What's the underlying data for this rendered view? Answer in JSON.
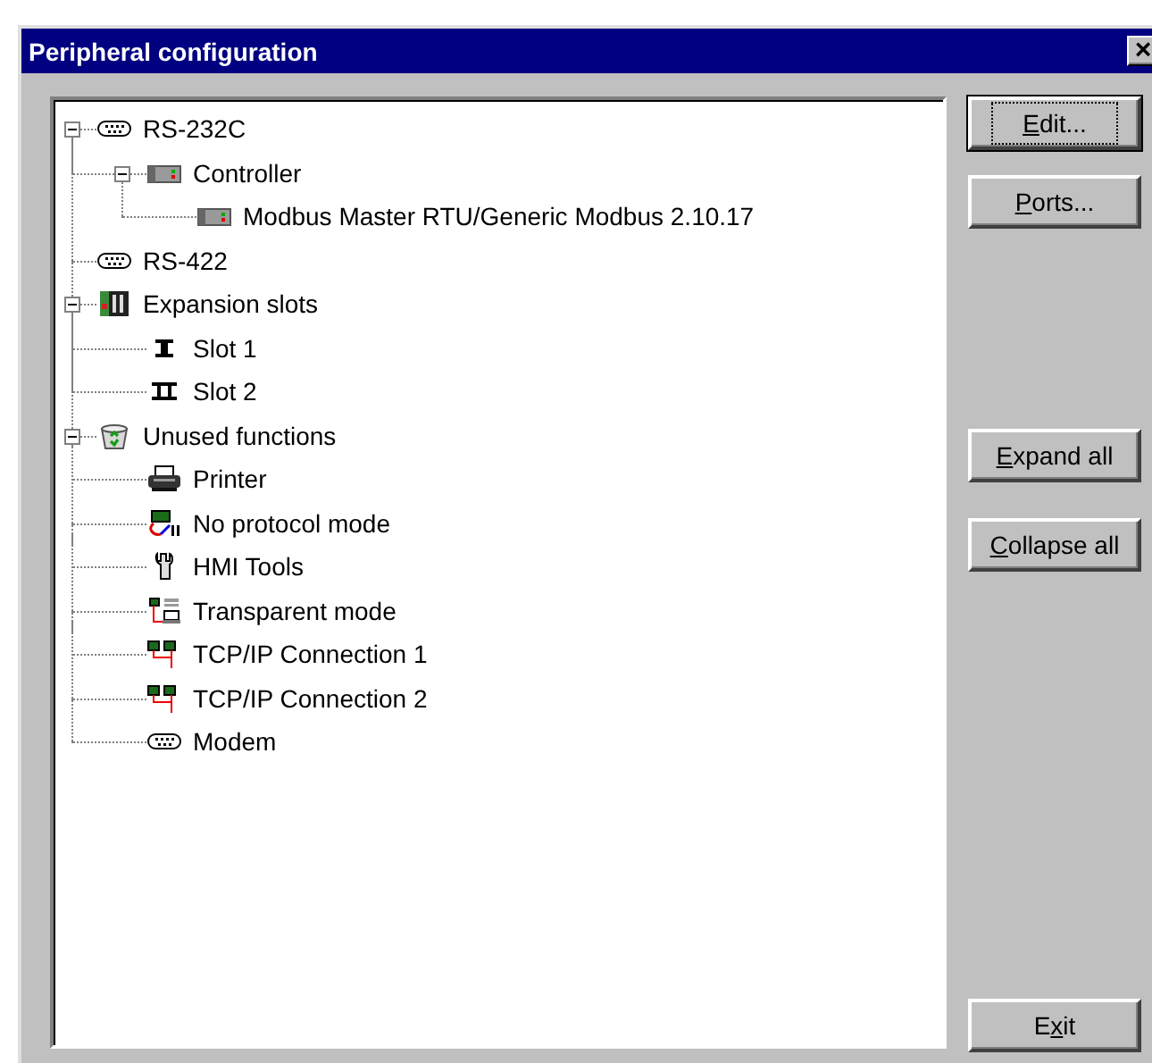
{
  "window": {
    "title": "Peripheral configuration",
    "close": "×"
  },
  "tree": [
    {
      "label": "RS-232C",
      "kind": "serial-port",
      "expanded": true,
      "children": [
        {
          "label": "Controller",
          "kind": "controller",
          "expanded": true,
          "children": [
            {
              "label": "Modbus Master RTU/Generic Modbus 2.10.17",
              "kind": "controller"
            }
          ]
        }
      ]
    },
    {
      "label": "RS-422",
      "kind": "serial-port"
    },
    {
      "label": "Expansion slots",
      "kind": "slots",
      "expanded": true,
      "children": [
        {
          "label": "Slot 1",
          "kind": "slot-1"
        },
        {
          "label": "Slot 2",
          "kind": "slot-2"
        }
      ]
    },
    {
      "label": "Unused functions",
      "kind": "recycle-bin",
      "expanded": true,
      "children": [
        {
          "label": "Printer",
          "kind": "printer"
        },
        {
          "label": "No protocol mode",
          "kind": "no-protocol"
        },
        {
          "label": "HMI Tools",
          "kind": "tool"
        },
        {
          "label": "Transparent mode",
          "kind": "transparent"
        },
        {
          "label": "TCP/IP Connection 1",
          "kind": "network"
        },
        {
          "label": "TCP/IP Connection 2",
          "kind": "network"
        },
        {
          "label": "Modem",
          "kind": "serial-port"
        }
      ]
    }
  ],
  "buttons": {
    "top": [
      {
        "key": "E",
        "after": "dit...",
        "focused": true
      },
      {
        "key": "P",
        "after": "orts...",
        "focused": false
      }
    ],
    "middle": [
      {
        "key": "E",
        "after": "xpand all",
        "focused": false
      },
      {
        "key": "C",
        "after": "ollapse all",
        "focused": false
      }
    ],
    "bottom": [
      {
        "before": "E",
        "key": "x",
        "after": "it",
        "focused": false
      }
    ]
  }
}
